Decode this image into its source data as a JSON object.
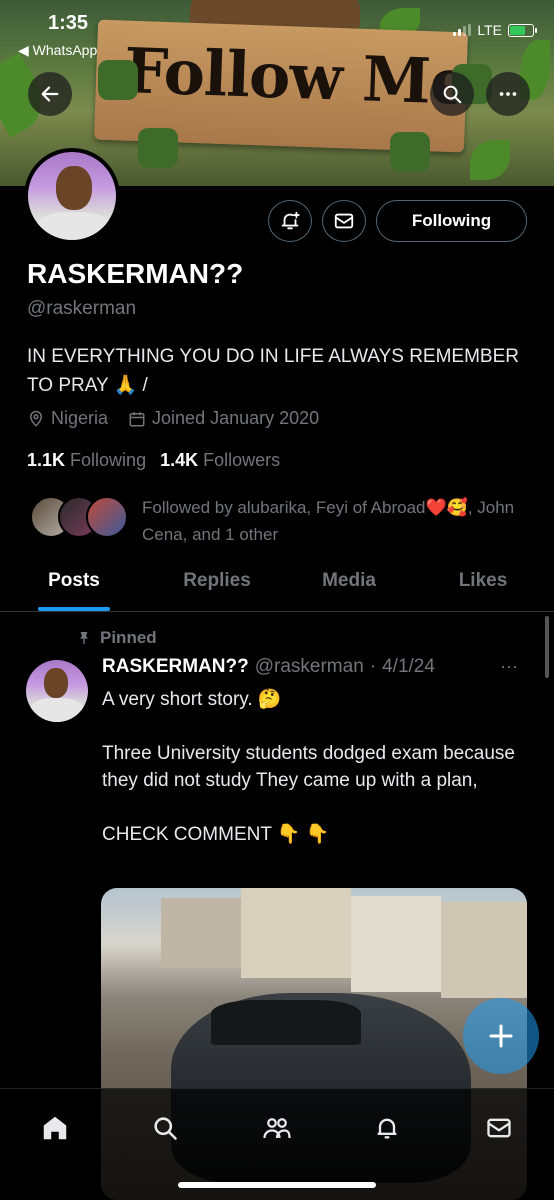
{
  "status_bar": {
    "time": "1:35",
    "back_app": "◀ WhatsApp",
    "network": "LTE",
    "battery_level": 0.7,
    "battery_color": "#34c759"
  },
  "banner": {
    "sign_text": "Follow Me"
  },
  "header_buttons": {
    "back_icon": "arrow-left-icon",
    "search_icon": "search-icon",
    "more_icon": "more-horizontal-icon"
  },
  "profile": {
    "display_name": "RASKERMAN??",
    "handle": "@raskerman",
    "bio": "IN EVERYTHING YOU DO IN LIFE ALWAYS REMEMBER TO PRAY 🙏 /",
    "location": "Nigeria",
    "joined": "Joined January 2020",
    "following_count": "1.1K",
    "following_label": "Following",
    "followers_count": "1.4K",
    "followers_label": "Followers",
    "follow_button": "Following",
    "followed_by": "Followed by alubarika, Feyi of Abroad❤️🥰, John Cena, and 1 other"
  },
  "tabs": [
    {
      "label": "Posts",
      "active": true
    },
    {
      "label": "Replies",
      "active": false
    },
    {
      "label": "Media",
      "active": false
    },
    {
      "label": "Likes",
      "active": false
    }
  ],
  "post": {
    "pinned_label": "Pinned",
    "author_name": "RASKERMAN??",
    "author_handle": "@raskerman",
    "separator": "·",
    "date": "4/1/24",
    "more": "···",
    "text": "A very short story. 🤔\n\nThree University students dodged exam because they did not study They came up with a plan,\n\nCHECK COMMENT 👇 👇"
  },
  "compose_fab": {
    "icon": "plus-icon"
  },
  "bottom_nav": [
    {
      "name": "home",
      "icon": "home-icon",
      "active": true
    },
    {
      "name": "search",
      "icon": "search-icon",
      "active": false
    },
    {
      "name": "communities",
      "icon": "people-icon",
      "active": false
    },
    {
      "name": "notifications",
      "icon": "bell-icon",
      "active": false
    },
    {
      "name": "messages",
      "icon": "mail-icon",
      "active": false
    }
  ],
  "colors": {
    "accent": "#1d9bf0",
    "muted_text": "#71767b",
    "background": "#000000"
  }
}
